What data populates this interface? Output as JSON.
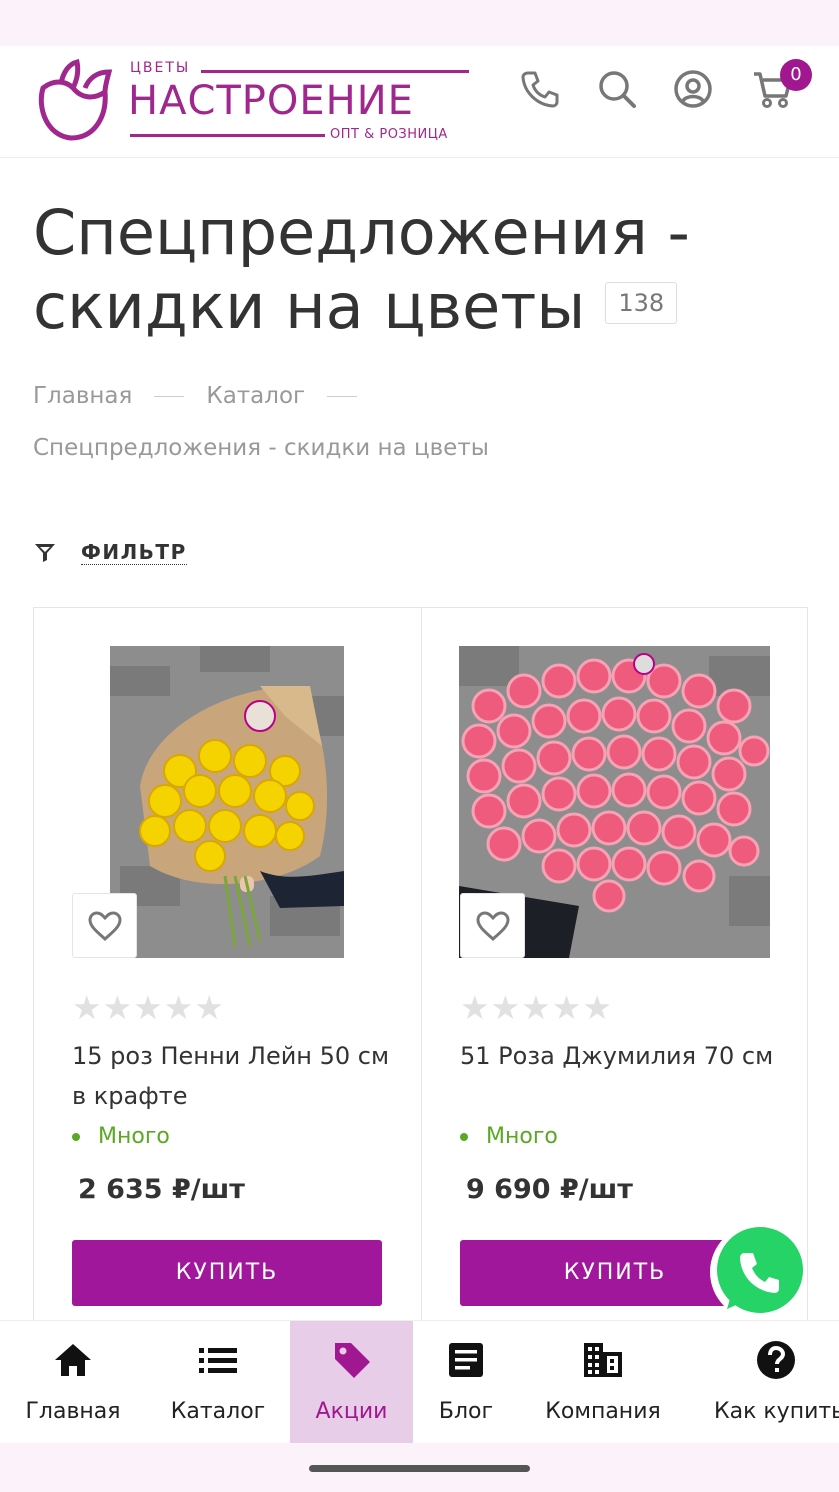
{
  "header": {
    "logo": {
      "small": "ЦВЕТЫ",
      "big": "НАСТРОЕНИЕ",
      "sub": "ОПТ & РОЗНИЦА"
    },
    "icons": [
      "phone-icon",
      "search-icon",
      "account-icon",
      "cart-icon"
    ],
    "cart_count": "0"
  },
  "page": {
    "title": "Спецпредложения - скидки на цветы",
    "count": "138"
  },
  "breadcrumb": {
    "items": [
      "Главная",
      "Каталог",
      "Спецпредложения - скидки на цветы"
    ]
  },
  "filter": {
    "label": "ФИЛЬТР"
  },
  "products": [
    {
      "name": "15 роз Пенни Лейн 50 см в крафте",
      "stars": "★★★★★",
      "stock": "Много",
      "price": "2 635 ₽/шт",
      "buy_label": "КУПИТЬ"
    },
    {
      "name": "51 Роза Джумилия 70 см",
      "stars": "★★★★★",
      "stock": "Много",
      "price": "9 690 ₽/шт",
      "buy_label": "КУПИТЬ"
    }
  ],
  "bottom_nav": {
    "items": [
      {
        "label": "Главная",
        "icon": "home-icon"
      },
      {
        "label": "Каталог",
        "icon": "list-icon"
      },
      {
        "label": "Акции",
        "icon": "tag-icon",
        "active": true
      },
      {
        "label": "Блог",
        "icon": "article-icon"
      },
      {
        "label": "Компания",
        "icon": "building-icon"
      },
      {
        "label": "Как купить",
        "icon": "help-icon"
      }
    ]
  },
  "colors": {
    "brand": "#a0178f",
    "stock_green": "#5aa824",
    "active_nav_bg": "#e8cde8",
    "whatsapp": "#25d366"
  }
}
